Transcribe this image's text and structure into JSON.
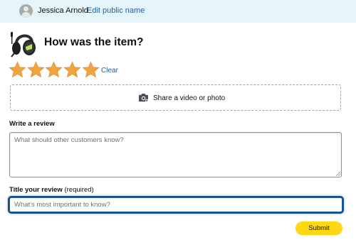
{
  "profile": {
    "name": "Jessica Arnold",
    "edit_link": "Edit public name",
    "avatar_icon": "user-avatar-icon"
  },
  "product": {
    "image_icon": "headset-product-icon",
    "question": "How was the item?"
  },
  "rating": {
    "value": 5,
    "max": 5,
    "star_color": "#f0a53c",
    "clear_label": "Clear"
  },
  "media": {
    "icon": "camera-icon",
    "label": "Share a video or photo"
  },
  "review": {
    "label": "Write a review",
    "placeholder": "What should other customers know?",
    "value": ""
  },
  "review_title": {
    "label": "Title your review",
    "label_suffix": "(required)",
    "placeholder": "What's most important to know?",
    "value": ""
  },
  "submit": {
    "label": "Submit",
    "color": "#ffd814"
  },
  "colors": {
    "profile_bar_bg": "#e6f4fb",
    "link": "#2162a1"
  }
}
